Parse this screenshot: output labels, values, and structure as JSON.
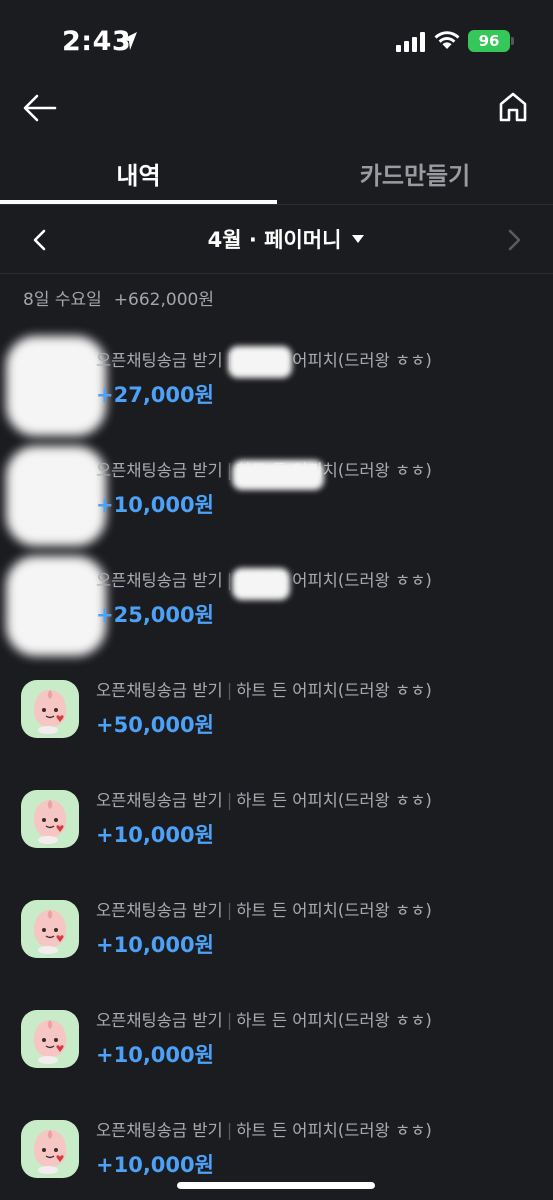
{
  "status_bar": {
    "time": "2:43",
    "battery": "96",
    "location_icon": "location-arrow-icon",
    "signal_icon": "cellular-signal-icon",
    "wifi_icon": "wifi-icon"
  },
  "nav": {
    "back_icon": "arrow-left-icon",
    "home_icon": "home-icon"
  },
  "tabs": [
    {
      "label": "내역",
      "active": true
    },
    {
      "label": "카드만들기",
      "active": false
    }
  ],
  "month_selector": {
    "label": "4월 · 페이머니",
    "prev_icon": "chevron-left-icon",
    "next_icon": "chevron-right-icon",
    "dropdown_icon": "caret-down-icon"
  },
  "date_group": {
    "date": "8일 수요일",
    "total": "+662,000원"
  },
  "transactions": [
    {
      "title": "오픈채팅송금 받기",
      "sender": "하트 든 어피치(드러왕 ㅎㅎ)",
      "amount": "+27,000원",
      "redacted": true
    },
    {
      "title": "오픈채팅송금 받기",
      "sender": "하트 든 어피치(드러왕 ㅎㅎ)",
      "amount": "+10,000원",
      "redacted": true
    },
    {
      "title": "오픈채팅송금 받기",
      "sender": "하트 든 어피치(드러왕 ㅎㅎ)",
      "amount": "+25,000원",
      "redacted": true
    },
    {
      "title": "오픈채팅송금 받기",
      "sender": "하트 든 어피치(드러왕 ㅎㅎ)",
      "amount": "+50,000원",
      "redacted": false
    },
    {
      "title": "오픈채팅송금 받기",
      "sender": "하트 든 어피치(드러왕 ㅎㅎ)",
      "amount": "+10,000원",
      "redacted": false
    },
    {
      "title": "오픈채팅송금 받기",
      "sender": "하트 든 어피치(드러왕 ㅎㅎ)",
      "amount": "+10,000원",
      "redacted": false
    },
    {
      "title": "오픈채팅송금 받기",
      "sender": "하트 든 어피치(드러왕 ㅎㅎ)",
      "amount": "+10,000원",
      "redacted": false
    },
    {
      "title": "오픈채팅송금 받기",
      "sender": "하트 든 어피치(드러왕 ㅎㅎ)",
      "amount": "+10,000원",
      "redacted": false
    }
  ],
  "colors": {
    "background": "#1b1c20",
    "amount": "#4da2f7",
    "avatar_bg": "#c9ecc8",
    "battery": "#35c759"
  }
}
